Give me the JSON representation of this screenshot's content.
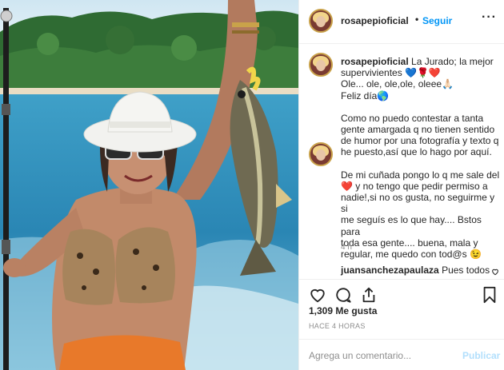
{
  "post": {
    "username": "rosapepioficial",
    "separator": "•",
    "follow_label": "Seguir",
    "more_icon": "more-options-icon",
    "more_label": "···"
  },
  "caption": {
    "username": "rosapepioficial",
    "line1": "La Jurado; la mejor",
    "line2": "supervivientes 💙🌹❤️",
    "line3": "Ole... ole, ole,ole, oleee🙏🏻",
    "line4": "Feliz día🌎",
    "para2_l1": "Como no puedo contestar a tanta",
    "para2_l2": "gente amargada q no tienen sentido",
    "para2_l3": "de humor por una fotografía y texto q",
    "para2_l4": "he puesto,así que lo hago por aquí.",
    "para3_l1": "De mi cuñada pongo lo q me sale del",
    "para3_l2": "❤️ y no tengo que pedir permiso a",
    "para3_l3": "nadie!,si no os gusta, no seguirme y si",
    "para3_l4": "me seguís es lo que hay.... Bstos para",
    "para3_l5": "toda esa gente.... buena, mala y",
    "para3_l6": "regular, me quedo con tod@s 😉",
    "time": "4 h"
  },
  "comment": {
    "username": "juansanchezapaulaza",
    "text": "Pues todos"
  },
  "actions": {
    "like_icon": "heart-icon",
    "comment_icon": "comment-icon",
    "share_icon": "share-icon",
    "save_icon": "bookmark-icon"
  },
  "likes": "1,309 Me gusta",
  "posted_ago": "HACE 4 HORAS",
  "add_comment": {
    "placeholder": "Agrega un comentario...",
    "post_label": "Publicar"
  },
  "colors": {
    "link": "#0095f6",
    "post_disabled": "#b2dffc",
    "secondary_text": "#8e8e8e",
    "avatar_ring": "#c9a24a"
  }
}
